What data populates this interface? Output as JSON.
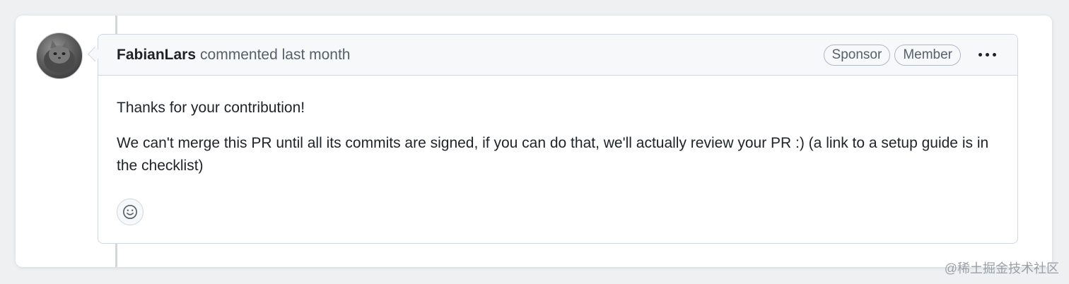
{
  "comment": {
    "author": "FabianLars",
    "meta": "commented last month",
    "badges": [
      "Sponsor",
      "Member"
    ],
    "body": [
      "Thanks for your contribution!",
      "We can't merge this PR until all its commits are signed, if you can do that, we'll actually review your PR :) (a link to a setup guide is in the checklist)"
    ]
  },
  "icons": {
    "more": "kebab-horizontal-icon",
    "reaction": "smiley-icon"
  },
  "watermark": "@稀土掘金技术社区"
}
